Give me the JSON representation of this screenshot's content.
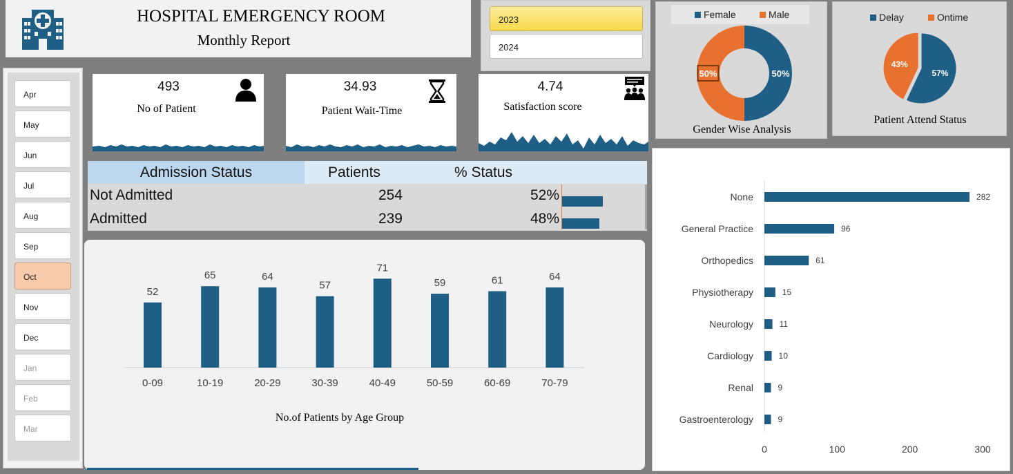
{
  "header": {
    "title": "HOSPITAL EMERGENCY ROOM",
    "subtitle": "Monthly Report",
    "logo_icon": "hospital-building-icon"
  },
  "year_slicer": {
    "items": [
      {
        "label": "2023",
        "selected": true
      },
      {
        "label": "2024",
        "selected": false
      }
    ]
  },
  "month_slicer": {
    "items": [
      {
        "label": "Apr",
        "state": "normal"
      },
      {
        "label": "May",
        "state": "normal"
      },
      {
        "label": "Jun",
        "state": "normal"
      },
      {
        "label": "Jul",
        "state": "normal"
      },
      {
        "label": "Aug",
        "state": "normal"
      },
      {
        "label": "Sep",
        "state": "normal"
      },
      {
        "label": "Oct",
        "state": "selected"
      },
      {
        "label": "Nov",
        "state": "normal"
      },
      {
        "label": "Dec",
        "state": "normal"
      },
      {
        "label": "Jan",
        "state": "dim"
      },
      {
        "label": "Feb",
        "state": "dim"
      },
      {
        "label": "Mar",
        "state": "dim"
      }
    ]
  },
  "kpis": {
    "patients": {
      "value": "493",
      "label": "No of Patient",
      "icon": "person-icon"
    },
    "wait_time": {
      "value": "34.93",
      "label": "Patient Wait-Time",
      "icon": "hourglass-icon"
    },
    "satisfaction": {
      "value": "4.74",
      "label": "Satisfaction score",
      "icon": "group-feedback-icon"
    }
  },
  "admission": {
    "headers": [
      "Admission Status",
      "Patients",
      "% Status"
    ],
    "rows": [
      {
        "status": "Not Admitted",
        "patients": "254",
        "pct": "52%",
        "fraction": 0.52
      },
      {
        "status": "Admitted",
        "patients": "239",
        "pct": "48%",
        "fraction": 0.48
      }
    ]
  },
  "colors": {
    "primary": "#1f5f86",
    "accent": "#e8712f",
    "selected_month": "#f8cbad",
    "selected_year": "#f7d84a"
  },
  "chart_data": [
    {
      "type": "bar",
      "title": "No.of Patients by Age Group",
      "categories": [
        "0-09",
        "10-19",
        "20-29",
        "30-39",
        "40-49",
        "50-59",
        "60-69",
        "70-79"
      ],
      "values": [
        52,
        65,
        64,
        57,
        71,
        59,
        61,
        64
      ],
      "data_labels": true,
      "grid": false
    },
    {
      "type": "pie",
      "subtype": "donut",
      "title": "Gender Wise Analysis",
      "legend_position": "top",
      "slices": [
        {
          "name": "Female",
          "value": 50,
          "label": "50%",
          "color": "#1f5f86"
        },
        {
          "name": "Male",
          "value": 50,
          "label": "50%",
          "color": "#e8712f"
        }
      ]
    },
    {
      "type": "pie",
      "title": "Patient Attend Status",
      "legend_position": "top",
      "slices": [
        {
          "name": "Delay",
          "value": 57,
          "label": "57%",
          "color": "#1f5f86"
        },
        {
          "name": "Ontime",
          "value": 43,
          "label": "43%",
          "color": "#e8712f"
        }
      ]
    },
    {
      "type": "bar",
      "orientation": "horizontal",
      "categories": [
        "None",
        "General Practice",
        "Orthopedics",
        "Physiotherapy",
        "Neurology",
        "Cardiology",
        "Renal",
        "Gastroenterology"
      ],
      "values": [
        282,
        96,
        61,
        15,
        11,
        10,
        9,
        9
      ],
      "xlim": [
        0,
        300
      ],
      "xticks": [
        "0",
        "100",
        "200",
        "300"
      ],
      "data_labels": true
    }
  ]
}
